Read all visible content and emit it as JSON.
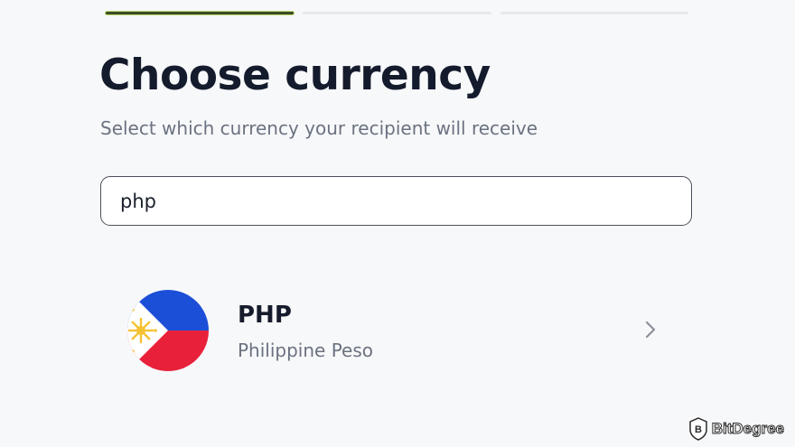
{
  "progress": {
    "steps_total": 3,
    "current_step": 1
  },
  "header": {
    "title": "Choose currency",
    "subtitle": "Select which currency your recipient will receive"
  },
  "search": {
    "value": "php"
  },
  "results": [
    {
      "code": "PHP",
      "name": "Philippine Peso",
      "flag_icon": "philippines-flag-icon"
    }
  ],
  "watermark": {
    "text": "BitDegree"
  },
  "colors": {
    "background": "#f7f8fa",
    "progress_done": "#3d4a25",
    "progress_pending": "#e6e8ec",
    "title": "#141b2d",
    "muted_text": "#6b7280",
    "flag_blue": "#1c4fd8",
    "flag_red": "#e8203a",
    "flag_yellow": "#f6c233"
  }
}
